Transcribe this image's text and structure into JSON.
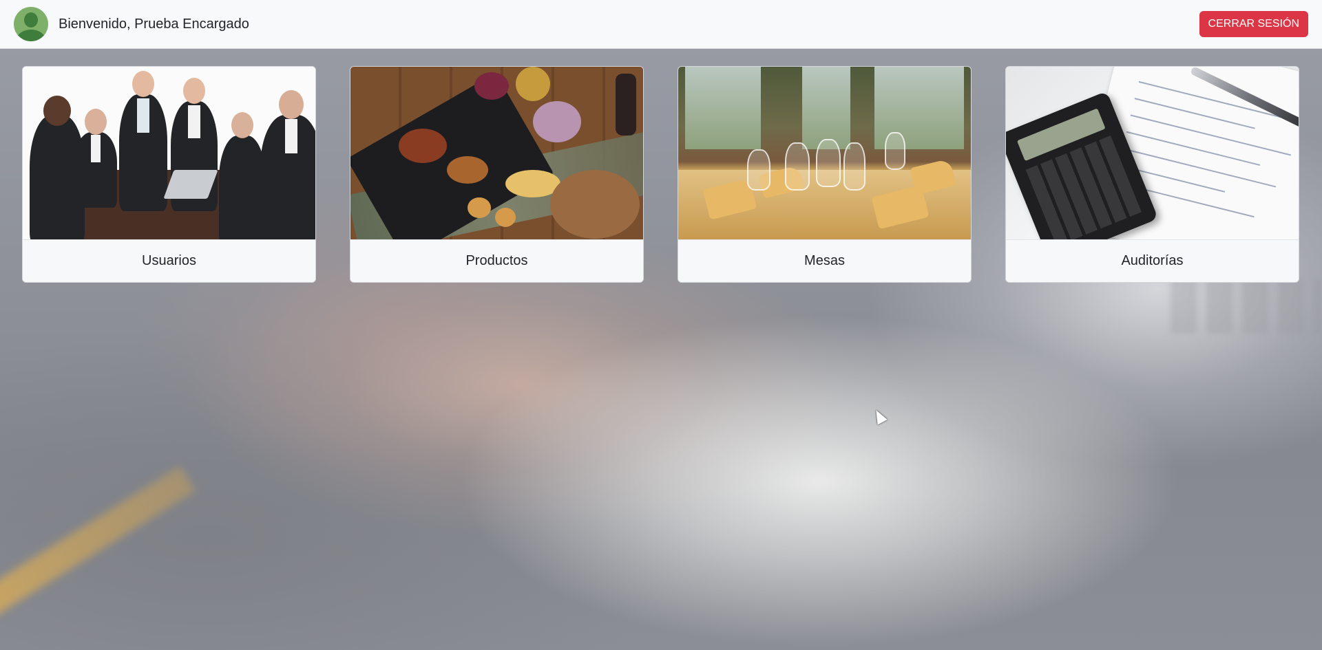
{
  "header": {
    "avatar_icon": "user-avatar-icon",
    "welcome_text": "Bienvenido, Prueba Encargado",
    "logout_label": "CERRAR SESIÓN"
  },
  "cards": [
    {
      "label": "Usuarios",
      "image": "business-meeting-photo"
    },
    {
      "label": "Productos",
      "image": "food-platter-photo"
    },
    {
      "label": "Mesas",
      "image": "restaurant-tables-photo"
    },
    {
      "label": "Auditorías",
      "image": "calculator-documents-photo"
    }
  ],
  "colors": {
    "header_bg": "#f8f9fa",
    "logout_bg": "#dc3545",
    "avatar_bg": "#7fb069",
    "card_footer_bg": "#f7f8f9"
  }
}
